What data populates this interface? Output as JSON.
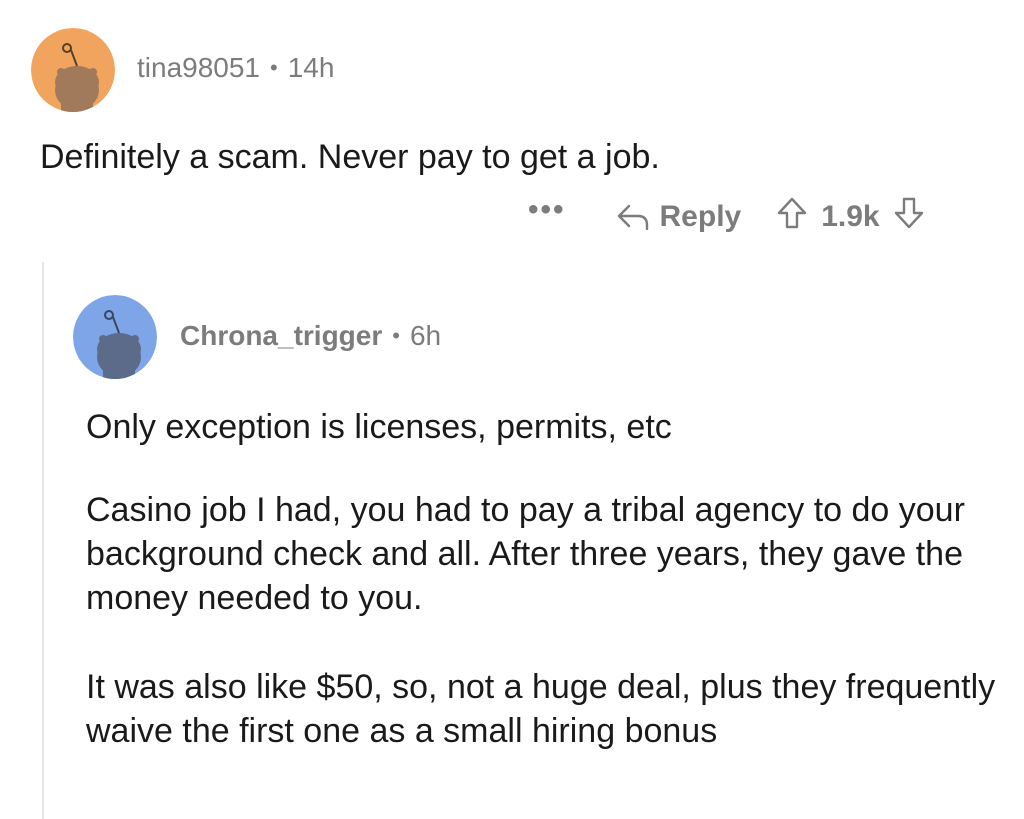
{
  "top_comment": {
    "username": "tina98051",
    "separator": "•",
    "age": "14h",
    "avatar_color": "#f0a45d",
    "text": "Definitely a scam. Never pay to get a job.",
    "more_label": "•••",
    "reply_label": "Reply",
    "score": "1.9k",
    "icons": {
      "more": "more-options-icon",
      "reply": "reply-arrow-icon",
      "upvote": "upvote-arrow-icon",
      "downvote": "downvote-arrow-icon"
    }
  },
  "reply_comment": {
    "username": "Chrona_trigger",
    "separator": "•",
    "age": "6h",
    "avatar_color": "#7ea5e8",
    "paragraphs": [
      "Only exception is licenses, permits, etc",
      "Casino job I had, you had to pay a tribal agency to do your background check and all.  After three years, they gave the money needed to you.",
      "It was also like $50, so, not a huge deal, plus they frequently waive the first one as a small hiring bonus"
    ]
  },
  "colors": {
    "text": "#1a1a1b",
    "meta": "#7c7c7c",
    "thread_line": "#e6e6e6"
  }
}
